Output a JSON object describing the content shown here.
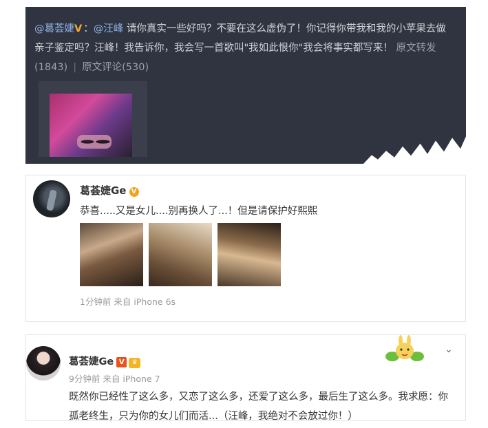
{
  "panel1": {
    "author": "@葛荟婕",
    "author_badge": "V",
    "colon": "：",
    "mention": "@汪峰",
    "body": "请你真实一些好吗？不要在这么虚伪了！你记得你带我和我的小苹果去做亲子鉴定吗？汪峰！我告诉你，我会写一首歌叫\"我如此恨你\"我会将事实都写来！",
    "repost_label": "原文转发(1843)",
    "separator": "|",
    "comment_label": "原文评论(530)"
  },
  "panel2": {
    "name": "葛荟婕Ge",
    "badge": "V",
    "text": "恭喜.....又是女儿....别再换人了...！但是请保护好熙熙",
    "meta": "1分钟前 来自 iPhone 6s"
  },
  "panel3": {
    "name": "葛荟婕Ge",
    "badge": "V",
    "vip_badge": "♛",
    "meta": "9分钟前 来自 iPhone 7",
    "text": "既然你已经性了这么多，又恋了这么多，还爱了这么多，最后生了这么多。我求愿：你孤老终生，只为你的女儿们而活...（汪峰，我绝对不会放过你！）",
    "chevron": "⌄"
  },
  "colors": {
    "dark_bg": "#2f3440",
    "link": "#8fb3e6",
    "vip_orange": "#f2a31a",
    "verified_red": "#e8541e"
  }
}
